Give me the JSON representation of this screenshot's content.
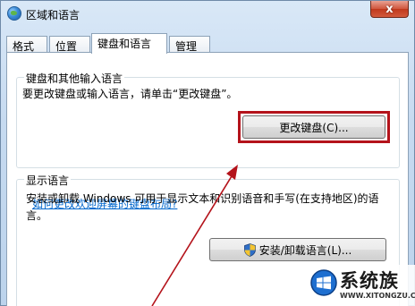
{
  "window": {
    "title": "区域和语言",
    "close_label": "x"
  },
  "tabs": [
    {
      "label": "格式"
    },
    {
      "label": "位置"
    },
    {
      "label": "键盘和语言"
    },
    {
      "label": "管理"
    }
  ],
  "active_tab": "键盘和语言",
  "keyboard_group": {
    "title": "键盘和其他输入语言",
    "description": "要更改键盘或输入语言，请单击“更改键盘”。",
    "change_button": "更改键盘(C)...",
    "help_link": "如何更改欢迎屏幕的键盘布局?"
  },
  "display_group": {
    "title": "显示语言",
    "description": "安装或卸载 Windows 可用于显示文本和识别语音和手写(在支持地区)的语言。",
    "install_button": "安装/卸载语言(L)..."
  },
  "annotation": {
    "highlight_color": "#b4131b",
    "arrow_color": "#b4131b"
  },
  "watermark": {
    "title": "系统族",
    "url": "WWW.XITONGZU.COM",
    "logo_icon": "windows-logo-icon"
  },
  "colors": {
    "link": "#0066cc",
    "close_button": "#c0391d"
  }
}
